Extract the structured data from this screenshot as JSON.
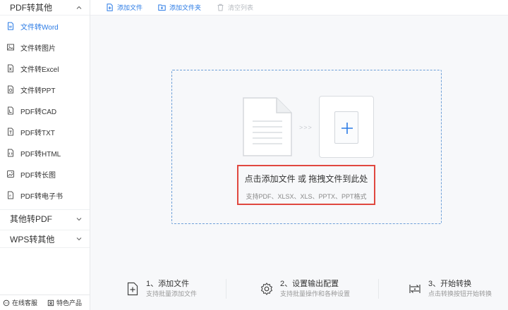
{
  "sidebar": {
    "group1": {
      "label": "PDF转其他",
      "state": "expanded"
    },
    "items": [
      {
        "label": "文件转Word",
        "icon": "word-file-icon",
        "active": true
      },
      {
        "label": "文件转图片",
        "icon": "image-icon",
        "active": false
      },
      {
        "label": "文件转Excel",
        "icon": "excel-file-icon",
        "active": false
      },
      {
        "label": "文件转PPT",
        "icon": "ppt-file-icon",
        "active": false
      },
      {
        "label": "PDF转CAD",
        "icon": "cad-file-icon",
        "active": false
      },
      {
        "label": "PDF转TXT",
        "icon": "txt-file-icon",
        "active": false
      },
      {
        "label": "PDF转HTML",
        "icon": "html-file-icon",
        "active": false
      },
      {
        "label": "PDF转长图",
        "icon": "long-image-icon",
        "active": false
      },
      {
        "label": "PDF转电子书",
        "icon": "ebook-icon",
        "active": false
      }
    ],
    "group2": {
      "label": "其他转PDF",
      "state": "collapsed"
    },
    "group3": {
      "label": "WPS转其他",
      "state": "collapsed"
    },
    "footer": {
      "support_label": "在线客服",
      "products_label": "特色产品"
    }
  },
  "toolbar": {
    "add_file_label": "添加文件",
    "add_folder_label": "添加文件夹",
    "clear_list_label": "清空列表",
    "clear_list_enabled": false
  },
  "dropzone": {
    "main_text": "点击添加文件 或 拖拽文件到此处",
    "sub_text": "支持PDF、XLSX、XLS、PPTX、PPT格式",
    "arrows": ">>>"
  },
  "steps": [
    {
      "title": "1、添加文件",
      "desc": "支持批量添加文件",
      "icon": "add-file-icon"
    },
    {
      "title": "2、设置输出配置",
      "desc": "支持批量操作和各种设置",
      "icon": "gear-icon"
    },
    {
      "title": "3、开始转换",
      "desc": "点击转换按钮开始转换",
      "icon": "convert-icon"
    }
  ],
  "colors": {
    "accent": "#2b7be5",
    "highlight_border": "#e0483f",
    "disabled": "#b8bcc2",
    "dashed_border": "#6d9fd8"
  }
}
